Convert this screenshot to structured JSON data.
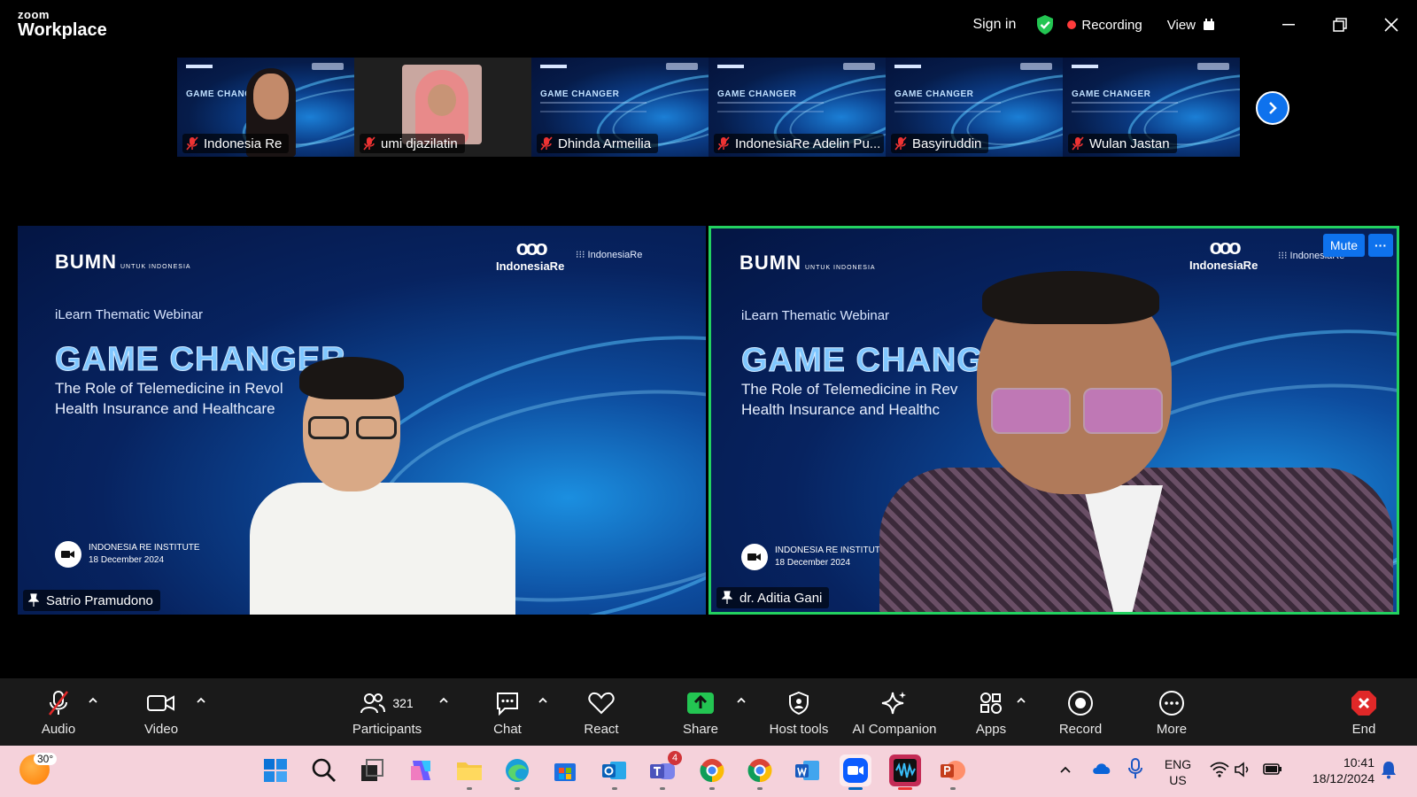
{
  "app": {
    "brand_small": "zoom",
    "brand_name": "Workplace",
    "sign_in": "Sign in",
    "recording": "Recording",
    "view": "View"
  },
  "thumbnails": [
    {
      "name": "Indonesia Re",
      "muted": true,
      "kind": "camera-slide"
    },
    {
      "name": "umi djazilatin",
      "muted": true,
      "kind": "avatar"
    },
    {
      "name": "Dhinda Armeilia",
      "muted": true,
      "kind": "slide"
    },
    {
      "name": "IndonesiaRe Adelin Pu...",
      "muted": true,
      "kind": "slide"
    },
    {
      "name": "Basyiruddin",
      "muted": true,
      "kind": "slide"
    },
    {
      "name": "Wulan Jastan",
      "muted": true,
      "kind": "slide"
    }
  ],
  "slide": {
    "thumb_title": "GAME CHANGER",
    "logo_bumn": "BUMN",
    "logo_bumn_small": "UNTUK INDONESIA",
    "logo_ire": "IndonesiaRe",
    "logo_iri": "IndonesiaRe",
    "eyebrow": "iLearn Thematic Webinar",
    "title_left": "GAME CHANGER",
    "title_right": "GAME CHANG",
    "desc_left_1": "The Role of Telemedicine in Revol",
    "desc_left_2": "Health Insurance and Healthcare",
    "desc_right_1": "The Role of Telemedicine in Rev",
    "desc_right_2": "Health Insurance and Healthc",
    "foot_1": "INDONESIA RE INSTITUTE",
    "foot_2": "18 December 2024"
  },
  "main_tiles": {
    "left": {
      "name": "Satrio Pramudono"
    },
    "right": {
      "name": "dr. Aditia Gani",
      "mute_label": "Mute",
      "more_label": "···",
      "speaking_color": "#23d160"
    }
  },
  "toolbar": {
    "audio": "Audio",
    "video": "Video",
    "participants": "Participants",
    "participants_count": "321",
    "chat": "Chat",
    "react": "React",
    "share": "Share",
    "host_tools": "Host tools",
    "ai_companion": "AI Companion",
    "apps": "Apps",
    "record": "Record",
    "more": "More",
    "end": "End"
  },
  "taskbar": {
    "temperature": "30°",
    "language_1": "ENG",
    "language_2": "US",
    "time": "10:41",
    "date": "18/12/2024",
    "teams_badge": "4"
  },
  "colors": {
    "accent": "#0e72ed",
    "recording_dot": "#ff3b3b",
    "end_red": "#e02828",
    "share_green": "#23c552"
  }
}
